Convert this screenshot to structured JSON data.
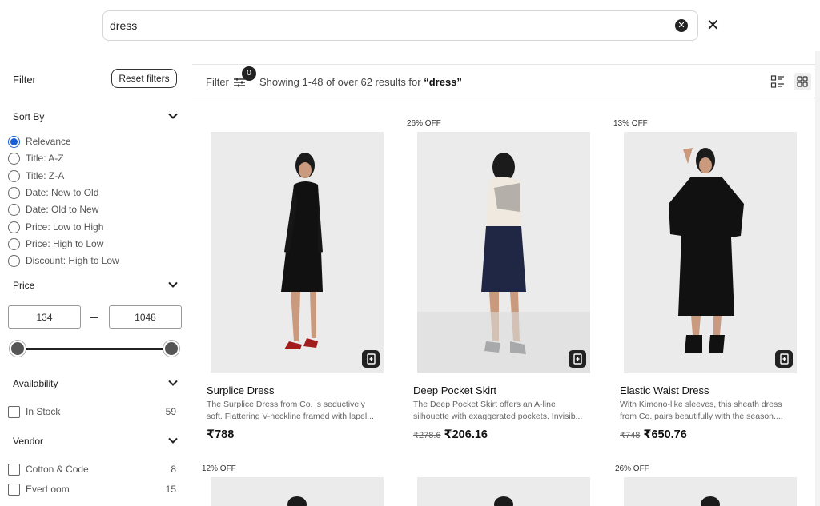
{
  "search": {
    "value": "dress",
    "placeholder": ""
  },
  "sidebar": {
    "filter_label": "Filter",
    "reset_label": "Reset filters",
    "sort_title": "Sort By",
    "sort_options": [
      {
        "label": "Relevance",
        "selected": true
      },
      {
        "label": "Title: A-Z",
        "selected": false
      },
      {
        "label": "Title: Z-A",
        "selected": false
      },
      {
        "label": "Date: New to Old",
        "selected": false
      },
      {
        "label": "Date: Old to New",
        "selected": false
      },
      {
        "label": "Price: Low to High",
        "selected": false
      },
      {
        "label": "Price: High to Low",
        "selected": false
      },
      {
        "label": "Discount: High to Low",
        "selected": false
      }
    ],
    "price_title": "Price",
    "price_min": "134",
    "price_max": "1048",
    "availability_title": "Availability",
    "availability_items": [
      {
        "label": "In Stock",
        "count": "59"
      }
    ],
    "vendor_title": "Vendor",
    "vendor_items": [
      {
        "label": "Cotton & Code",
        "count": "8"
      },
      {
        "label": "EverLoom",
        "count": "15"
      }
    ]
  },
  "toolbar": {
    "filter_label": "Filter",
    "filter_count": "0",
    "results_prefix": "Showing 1-48 of over 62 results for",
    "results_query": "“dress”"
  },
  "products": [
    {
      "badge": "",
      "title": "Surplice Dress",
      "desc1": "The Surplice Dress from Co. is seductively",
      "desc2": "soft. Flattering V-neckline framed with lapel...",
      "old_price": "",
      "price": "₹788"
    },
    {
      "badge": "26% OFF",
      "title": "Deep Pocket Skirt",
      "desc1": "The Deep Pocket Skirt offers an A-line",
      "desc2": "silhouette with exaggerated pockets. Invisib...",
      "old_price": "₹278.6",
      "price": "₹206.16"
    },
    {
      "badge": "13% OFF",
      "title": "Elastic Waist Dress",
      "desc1": "With Kimono-like sleeves, this sheath dress",
      "desc2": "from Co. pairs beautifully with the season....",
      "old_price": "₹748",
      "price": "₹650.76"
    }
  ],
  "next_row_badges": [
    "12% OFF",
    "",
    "26% OFF"
  ],
  "colors": {
    "accent": "#1a5dd8",
    "text": "#222222",
    "thumb_bg": "#ebebeb"
  },
  "icons": {
    "clear": "circle-x-icon",
    "close": "close-icon",
    "chevron": "chevron-down-icon",
    "filter": "sliders-icon",
    "list_view": "list-view-icon",
    "grid_view": "grid-view-icon",
    "quick_add": "quick-add-icon"
  }
}
